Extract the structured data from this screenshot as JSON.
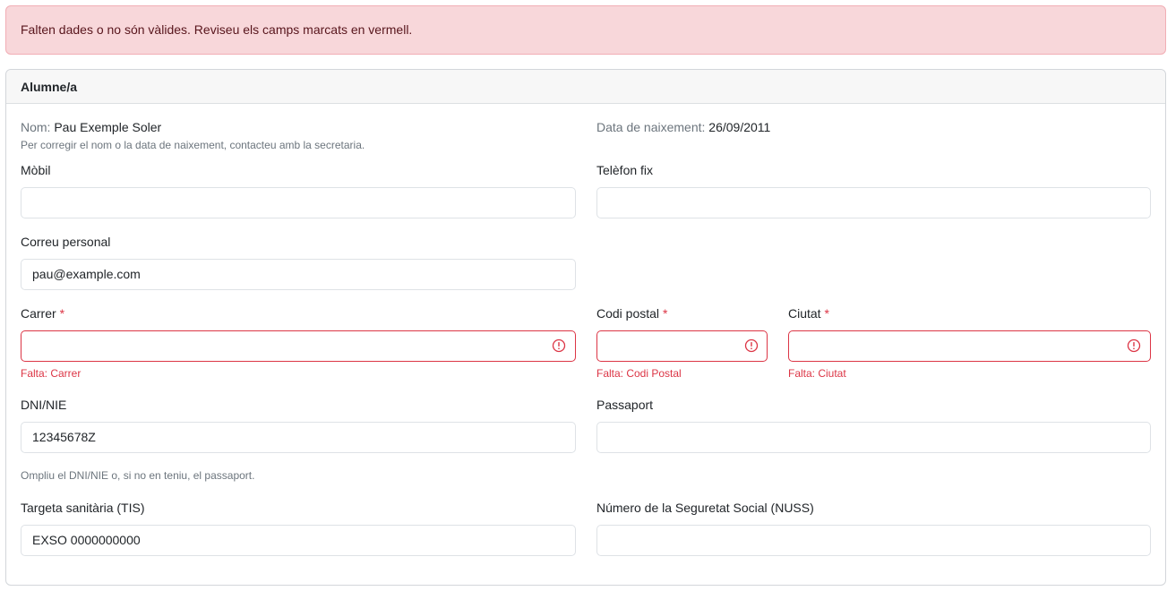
{
  "alert": {
    "message": "Falten dades o no són vàlides. Reviseu els camps marcats en vermell."
  },
  "card": {
    "title": "Alumne/a",
    "name_label": "Nom:",
    "name_value": "Pau Exemple Soler",
    "name_help": "Per corregir el nom o la data de naixement, contacteu amb la secretaria.",
    "birth_label": "Data de naixement:",
    "birth_value": "26/09/2011"
  },
  "fields": {
    "mobile": {
      "label": "Mòbil",
      "value": ""
    },
    "landline": {
      "label": "Telèfon fix",
      "value": ""
    },
    "email": {
      "label": "Correu personal",
      "value": "pau@example.com"
    },
    "street": {
      "label": "Carrer",
      "required_mark": "*",
      "value": "",
      "error": "Falta: Carrer"
    },
    "postal_code": {
      "label": "Codi postal",
      "required_mark": "*",
      "value": "",
      "error": "Falta: Codi Postal"
    },
    "city": {
      "label": "Ciutat",
      "required_mark": "*",
      "value": "",
      "error": "Falta: Ciutat"
    },
    "dni": {
      "label": "DNI/NIE",
      "value": "12345678Z"
    },
    "passport": {
      "label": "Passaport",
      "value": ""
    },
    "id_help": "Ompliu el DNI/NIE o, si no en teniu, el passaport.",
    "tis": {
      "label": "Targeta sanitària (TIS)",
      "value": "EXSO 0000000000"
    },
    "nuss": {
      "label": "Número de la Seguretat Social (NUSS)",
      "value": ""
    }
  },
  "colors": {
    "alert_bg": "#f8d7da",
    "alert_text": "#58151c",
    "error": "#dc3545",
    "border": "#dee2e6"
  },
  "icons": {
    "invalid": "exclamation-circle-icon"
  }
}
